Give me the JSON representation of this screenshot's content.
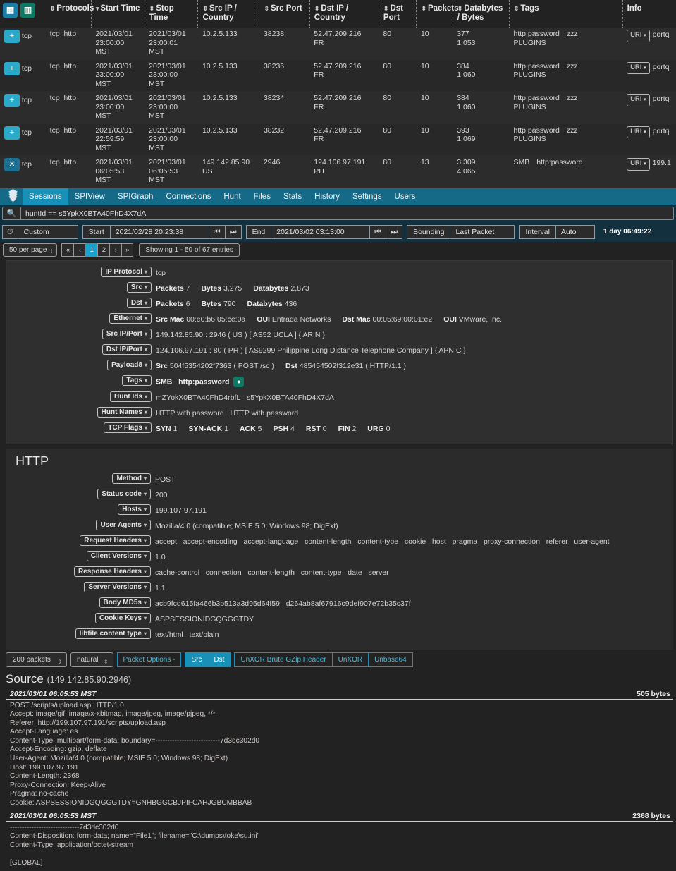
{
  "toolbar_icons": {
    "grid": "grid-icon",
    "columns": "columns-icon"
  },
  "table": {
    "columns": [
      {
        "label": "Protocols",
        "sortable": true,
        "dir": "none"
      },
      {
        "label": "Start Time",
        "sortable": true,
        "dir": "desc"
      },
      {
        "label": "Stop Time",
        "sortable": true,
        "dir": "none"
      },
      {
        "label": "Src IP / Country",
        "sortable": true,
        "dir": "none"
      },
      {
        "label": "Src Port",
        "sortable": true,
        "dir": "none"
      },
      {
        "label": "Dst IP / Country",
        "sortable": true,
        "dir": "none"
      },
      {
        "label": "Dst Port",
        "sortable": true,
        "dir": "none"
      },
      {
        "label": "Packets",
        "sortable": true,
        "dir": "none"
      },
      {
        "label": "Databytes / Bytes",
        "sortable": true,
        "dir": "none"
      },
      {
        "label": "Tags",
        "sortable": true,
        "dir": "none"
      },
      {
        "label": "Info",
        "sortable": false,
        "dir": "none"
      }
    ],
    "rows": [
      {
        "expand": "+",
        "proto": "tcp",
        "proto2": "tcp",
        "proto3": "http",
        "start1": "2021/03/01",
        "start2": "23:00:00 MST",
        "stop1": "2021/03/01",
        "stop2": "23:00:01 MST",
        "src_ip": "10.2.5.133",
        "src_cc": "",
        "src_port": "38238",
        "dst_ip": "52.47.209.216",
        "dst_cc": "FR",
        "dst_port": "80",
        "packets": "10",
        "databytes": "377",
        "bytes": "1,053",
        "tags": [
          "http:password",
          "zzz",
          "PLUGINS"
        ],
        "info_btn": "URI",
        "info_text": "portq"
      },
      {
        "expand": "+",
        "proto": "tcp",
        "proto2": "tcp",
        "proto3": "http",
        "start1": "2021/03/01",
        "start2": "23:00:00 MST",
        "stop1": "2021/03/01",
        "stop2": "23:00:00 MST",
        "src_ip": "10.2.5.133",
        "src_cc": "",
        "src_port": "38236",
        "dst_ip": "52.47.209.216",
        "dst_cc": "FR",
        "dst_port": "80",
        "packets": "10",
        "databytes": "384",
        "bytes": "1,060",
        "tags": [
          "http:password",
          "zzz",
          "PLUGINS"
        ],
        "info_btn": "URI",
        "info_text": "portq"
      },
      {
        "expand": "+",
        "proto": "tcp",
        "proto2": "tcp",
        "proto3": "http",
        "start1": "2021/03/01",
        "start2": "23:00:00 MST",
        "stop1": "2021/03/01",
        "stop2": "23:00:00 MST",
        "src_ip": "10.2.5.133",
        "src_cc": "",
        "src_port": "38234",
        "dst_ip": "52.47.209.216",
        "dst_cc": "FR",
        "dst_port": "80",
        "packets": "10",
        "databytes": "384",
        "bytes": "1,060",
        "tags": [
          "http:password",
          "zzz",
          "PLUGINS"
        ],
        "info_btn": "URI",
        "info_text": "portq"
      },
      {
        "expand": "+",
        "proto": "tcp",
        "proto2": "tcp",
        "proto3": "http",
        "start1": "2021/03/01",
        "start2": "22:59:59 MST",
        "stop1": "2021/03/01",
        "stop2": "23:00:00 MST",
        "src_ip": "10.2.5.133",
        "src_cc": "",
        "src_port": "38232",
        "dst_ip": "52.47.209.216",
        "dst_cc": "FR",
        "dst_port": "80",
        "packets": "10",
        "databytes": "393",
        "bytes": "1,069",
        "tags": [
          "http:password",
          "zzz",
          "PLUGINS"
        ],
        "info_btn": "URI",
        "info_text": "portq"
      },
      {
        "expand": "x",
        "proto": "tcp",
        "proto2": "tcp",
        "proto3": "http",
        "start1": "2021/03/01",
        "start2": "06:05:53 MST",
        "stop1": "2021/03/01",
        "stop2": "06:05:53 MST",
        "src_ip": "149.142.85.90",
        "src_cc": "US",
        "src_port": "2946",
        "dst_ip": "124.106.97.191",
        "dst_cc": "PH",
        "dst_port": "80",
        "packets": "13",
        "databytes": "3,309",
        "bytes": "4,065",
        "tags": [
          "SMB",
          "http:password"
        ],
        "info_btn": "URI",
        "info_text": "199.1"
      }
    ]
  },
  "nav": {
    "logo": "moloch-logo-icon",
    "items": [
      {
        "label": "Sessions",
        "active": true
      },
      {
        "label": "SPIView",
        "active": false
      },
      {
        "label": "SPIGraph",
        "active": false
      },
      {
        "label": "Connections",
        "active": false
      },
      {
        "label": "Hunt",
        "active": false
      },
      {
        "label": "Files",
        "active": false
      },
      {
        "label": "Stats",
        "active": false
      },
      {
        "label": "History",
        "active": false
      },
      {
        "label": "Settings",
        "active": false
      },
      {
        "label": "Users",
        "active": false
      }
    ]
  },
  "search": {
    "icon": "search-icon",
    "value": "huntId == s5YpkX0BTA40FhD4X7dA",
    "placeholder": "Search"
  },
  "timebar": {
    "clock_icon": "clock-icon",
    "range_label": "Custom",
    "start_label": "Start",
    "start_value": "2021/02/28 20:23:38",
    "end_label": "End",
    "end_value": "2021/03/02 03:13:00",
    "bounding_label": "Bounding",
    "bounding_value": "Last Packet",
    "interval_label": "Interval",
    "interval_value": "Auto",
    "duration": "1 day 06:49:22",
    "nav_first_icon": "skip-back-icon",
    "nav_last_icon": "skip-forward-icon"
  },
  "paging": {
    "per_page": "50 per page",
    "buttons": [
      "«",
      "‹",
      "1",
      "2",
      "›",
      "»"
    ],
    "active_page": "1",
    "showing": "Showing 1 - 50 of 67 entries"
  },
  "detail": {
    "rows": [
      {
        "label": "IP Protocol",
        "kind": "plain",
        "value": "tcp"
      },
      {
        "label": "Src",
        "kind": "stats",
        "pairs": [
          [
            "Packets",
            "7"
          ],
          [
            "Bytes",
            "3,275"
          ],
          [
            "Databytes",
            "2,873"
          ]
        ]
      },
      {
        "label": "Dst",
        "kind": "stats",
        "pairs": [
          [
            "Packets",
            "6"
          ],
          [
            "Bytes",
            "790"
          ],
          [
            "Databytes",
            "436"
          ]
        ]
      },
      {
        "label": "Ethernet",
        "kind": "stats",
        "pairs": [
          [
            "Src Mac",
            "00:e0:b6:05:ce:0a"
          ],
          [
            "OUI",
            "Entrada Networks"
          ],
          [
            "Dst Mac",
            "00:05:69:00:01:e2"
          ],
          [
            "OUI",
            "VMware, Inc."
          ]
        ]
      },
      {
        "label": "Src IP/Port",
        "kind": "plain",
        "value": "149.142.85.90 : 2946  ( US )  [ AS52 UCLA ]  { ARIN }"
      },
      {
        "label": "Dst IP/Port",
        "kind": "plain",
        "value": "124.106.97.191 : 80  ( PH )  [ AS9299 Philippine Long Distance Telephone Company ]  { APNIC }"
      },
      {
        "label": "Payload8",
        "kind": "stats",
        "pairs": [
          [
            "Src",
            "504f5354202f7363  ( POST /sc )"
          ],
          [
            "Dst",
            "485454502f312e31  ( HTTP/1.1 )"
          ]
        ]
      },
      {
        "label": "Tags",
        "kind": "tags",
        "values": [
          "SMB",
          "http:password"
        ],
        "tag_button_icon": "add-tag-icon"
      },
      {
        "label": "Hunt Ids",
        "kind": "list",
        "values": [
          "mZYokX0BTA40FhD4rbfL",
          "s5YpkX0BTA40FhD4X7dA"
        ]
      },
      {
        "label": "Hunt Names",
        "kind": "list",
        "values": [
          "HTTP with password",
          "HTTP with password"
        ]
      },
      {
        "label": "TCP Flags",
        "kind": "stats",
        "pairs": [
          [
            "SYN",
            "1"
          ],
          [
            "SYN-ACK",
            "1"
          ],
          [
            "ACK",
            "5"
          ],
          [
            "PSH",
            "4"
          ],
          [
            "RST",
            "0"
          ],
          [
            "FIN",
            "2"
          ],
          [
            "URG",
            "0"
          ]
        ]
      }
    ]
  },
  "http": {
    "title": "HTTP",
    "rows": [
      {
        "label": "Method",
        "values": [
          "POST"
        ]
      },
      {
        "label": "Status code",
        "values": [
          "200"
        ]
      },
      {
        "label": "Hosts",
        "values": [
          "199.107.97.191"
        ]
      },
      {
        "label": "User Agents",
        "values": [
          "Mozilla/4.0 (compatible; MSIE 5.0; Windows 98; DigExt)"
        ]
      },
      {
        "label": "Request Headers",
        "values": [
          "accept",
          "accept-encoding",
          "accept-language",
          "content-length",
          "content-type",
          "cookie",
          "host",
          "pragma",
          "proxy-connection",
          "referer",
          "user-agent"
        ]
      },
      {
        "label": "Client Versions",
        "values": [
          "1.0"
        ]
      },
      {
        "label": "Response Headers",
        "values": [
          "cache-control",
          "connection",
          "content-length",
          "content-type",
          "date",
          "server"
        ]
      },
      {
        "label": "Server Versions",
        "values": [
          "1.1"
        ]
      },
      {
        "label": "Body MD5s",
        "values": [
          "acb9fcd615fa466b3b513a3d95d64f59",
          "d264ab8af67916c9def907e72b35c37f"
        ]
      },
      {
        "label": "Cookie Keys",
        "values": [
          "ASPSESSIONIDGQGGGTDY"
        ]
      },
      {
        "label": "libfile content type",
        "values": [
          "text/html",
          "text/plain"
        ]
      }
    ]
  },
  "packet_toolbar": {
    "count": "200 packets",
    "format": "natural",
    "packet_options": "Packet Options -",
    "src_label": "Src",
    "dst_label": "Dst",
    "unxor_brute": "UnXOR Brute GZip Header",
    "unxor": "UnXOR",
    "unbase64": "Unbase64"
  },
  "source": {
    "title": "Source",
    "endpoint": "(149.142.85.90:2946)",
    "packets": [
      {
        "timestamp": "2021/03/01 06:05:53 MST",
        "bytes": "505 bytes",
        "body": "POST /scripts/upload.asp HTTP/1.0\nAccept: image/gif, image/x-xbitmap, image/jpeg, image/pjpeg, */*\nReferer: http://199.107.97.191/scripts/upload.asp\nAccept-Language: es\nContent-Type: multipart/form-data; boundary=---------------------------7d3dc302d0\nAccept-Encoding: gzip, deflate\nUser-Agent: Mozilla/4.0 (compatible; MSIE 5.0; Windows 98; DigExt)\nHost: 199.107.97.191\nContent-Length: 2368\nProxy-Connection: Keep-Alive\nPragma: no-cache\nCookie: ASPSESSIONIDGQGGGTDY=GNHBGGCBJPIFCAHJGBCMBBAB\n"
      },
      {
        "timestamp": "2021/03/01 06:05:53 MST",
        "bytes": "2368 bytes",
        "body": "-----------------------------7d3dc302d0\nContent-Disposition: form-data; name=\"File1\"; filename=\"C:\\dumps\\toke\\su.ini\"\nContent-Type: application/octet-stream\n\n[GLOBAL]"
      }
    ]
  }
}
